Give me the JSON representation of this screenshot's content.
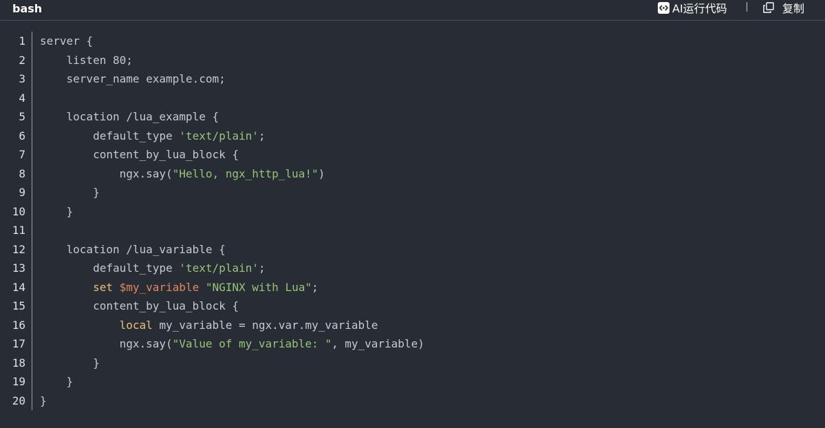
{
  "header": {
    "language": "bash",
    "ai_run_label": "AI运行代码",
    "copy_label": "复制"
  },
  "icons": {
    "ai_run": "code-brackets-icon",
    "copy": "copy-icon"
  },
  "colors": {
    "background": "#282c34",
    "string": "#98c379",
    "keyword": "#e5c07b",
    "variable": "#e0875f",
    "text": "#c5cad3"
  },
  "code": {
    "lines": [
      {
        "n": "1",
        "tokens": [
          {
            "t": "server {",
            "c": ""
          }
        ]
      },
      {
        "n": "2",
        "tokens": [
          {
            "t": "    listen 80;",
            "c": ""
          }
        ]
      },
      {
        "n": "3",
        "tokens": [
          {
            "t": "    server_name example.com;",
            "c": ""
          }
        ]
      },
      {
        "n": "4",
        "tokens": [
          {
            "t": "",
            "c": ""
          }
        ]
      },
      {
        "n": "5",
        "tokens": [
          {
            "t": "    location /lua_example {",
            "c": ""
          }
        ]
      },
      {
        "n": "6",
        "tokens": [
          {
            "t": "        default_type ",
            "c": ""
          },
          {
            "t": "'text/plain'",
            "c": "str"
          },
          {
            "t": ";",
            "c": ""
          }
        ]
      },
      {
        "n": "7",
        "tokens": [
          {
            "t": "        content_by_lua_block {",
            "c": ""
          }
        ]
      },
      {
        "n": "8",
        "tokens": [
          {
            "t": "            ngx.say(",
            "c": ""
          },
          {
            "t": "\"Hello, ngx_http_lua!\"",
            "c": "str"
          },
          {
            "t": ")",
            "c": ""
          }
        ]
      },
      {
        "n": "9",
        "tokens": [
          {
            "t": "        }",
            "c": ""
          }
        ]
      },
      {
        "n": "10",
        "tokens": [
          {
            "t": "    }",
            "c": ""
          }
        ]
      },
      {
        "n": "11",
        "tokens": [
          {
            "t": "",
            "c": ""
          }
        ]
      },
      {
        "n": "12",
        "tokens": [
          {
            "t": "    location /lua_variable {",
            "c": ""
          }
        ]
      },
      {
        "n": "13",
        "tokens": [
          {
            "t": "        default_type ",
            "c": ""
          },
          {
            "t": "'text/plain'",
            "c": "str"
          },
          {
            "t": ";",
            "c": ""
          }
        ]
      },
      {
        "n": "14",
        "tokens": [
          {
            "t": "        ",
            "c": ""
          },
          {
            "t": "set",
            "c": "kw"
          },
          {
            "t": " ",
            "c": ""
          },
          {
            "t": "$my_variable",
            "c": "var"
          },
          {
            "t": " ",
            "c": ""
          },
          {
            "t": "\"NGINX with Lua\"",
            "c": "str"
          },
          {
            "t": ";",
            "c": ""
          }
        ]
      },
      {
        "n": "15",
        "tokens": [
          {
            "t": "        content_by_lua_block {",
            "c": ""
          }
        ]
      },
      {
        "n": "16",
        "tokens": [
          {
            "t": "            ",
            "c": ""
          },
          {
            "t": "local",
            "c": "kw"
          },
          {
            "t": " my_variable = ngx.var.my_variable",
            "c": ""
          }
        ]
      },
      {
        "n": "17",
        "tokens": [
          {
            "t": "            ngx.say(",
            "c": ""
          },
          {
            "t": "\"Value of my_variable: \"",
            "c": "str"
          },
          {
            "t": ", my_variable)",
            "c": ""
          }
        ]
      },
      {
        "n": "18",
        "tokens": [
          {
            "t": "        }",
            "c": ""
          }
        ]
      },
      {
        "n": "19",
        "tokens": [
          {
            "t": "    }",
            "c": ""
          }
        ]
      },
      {
        "n": "20",
        "tokens": [
          {
            "t": "}",
            "c": ""
          }
        ]
      }
    ]
  }
}
